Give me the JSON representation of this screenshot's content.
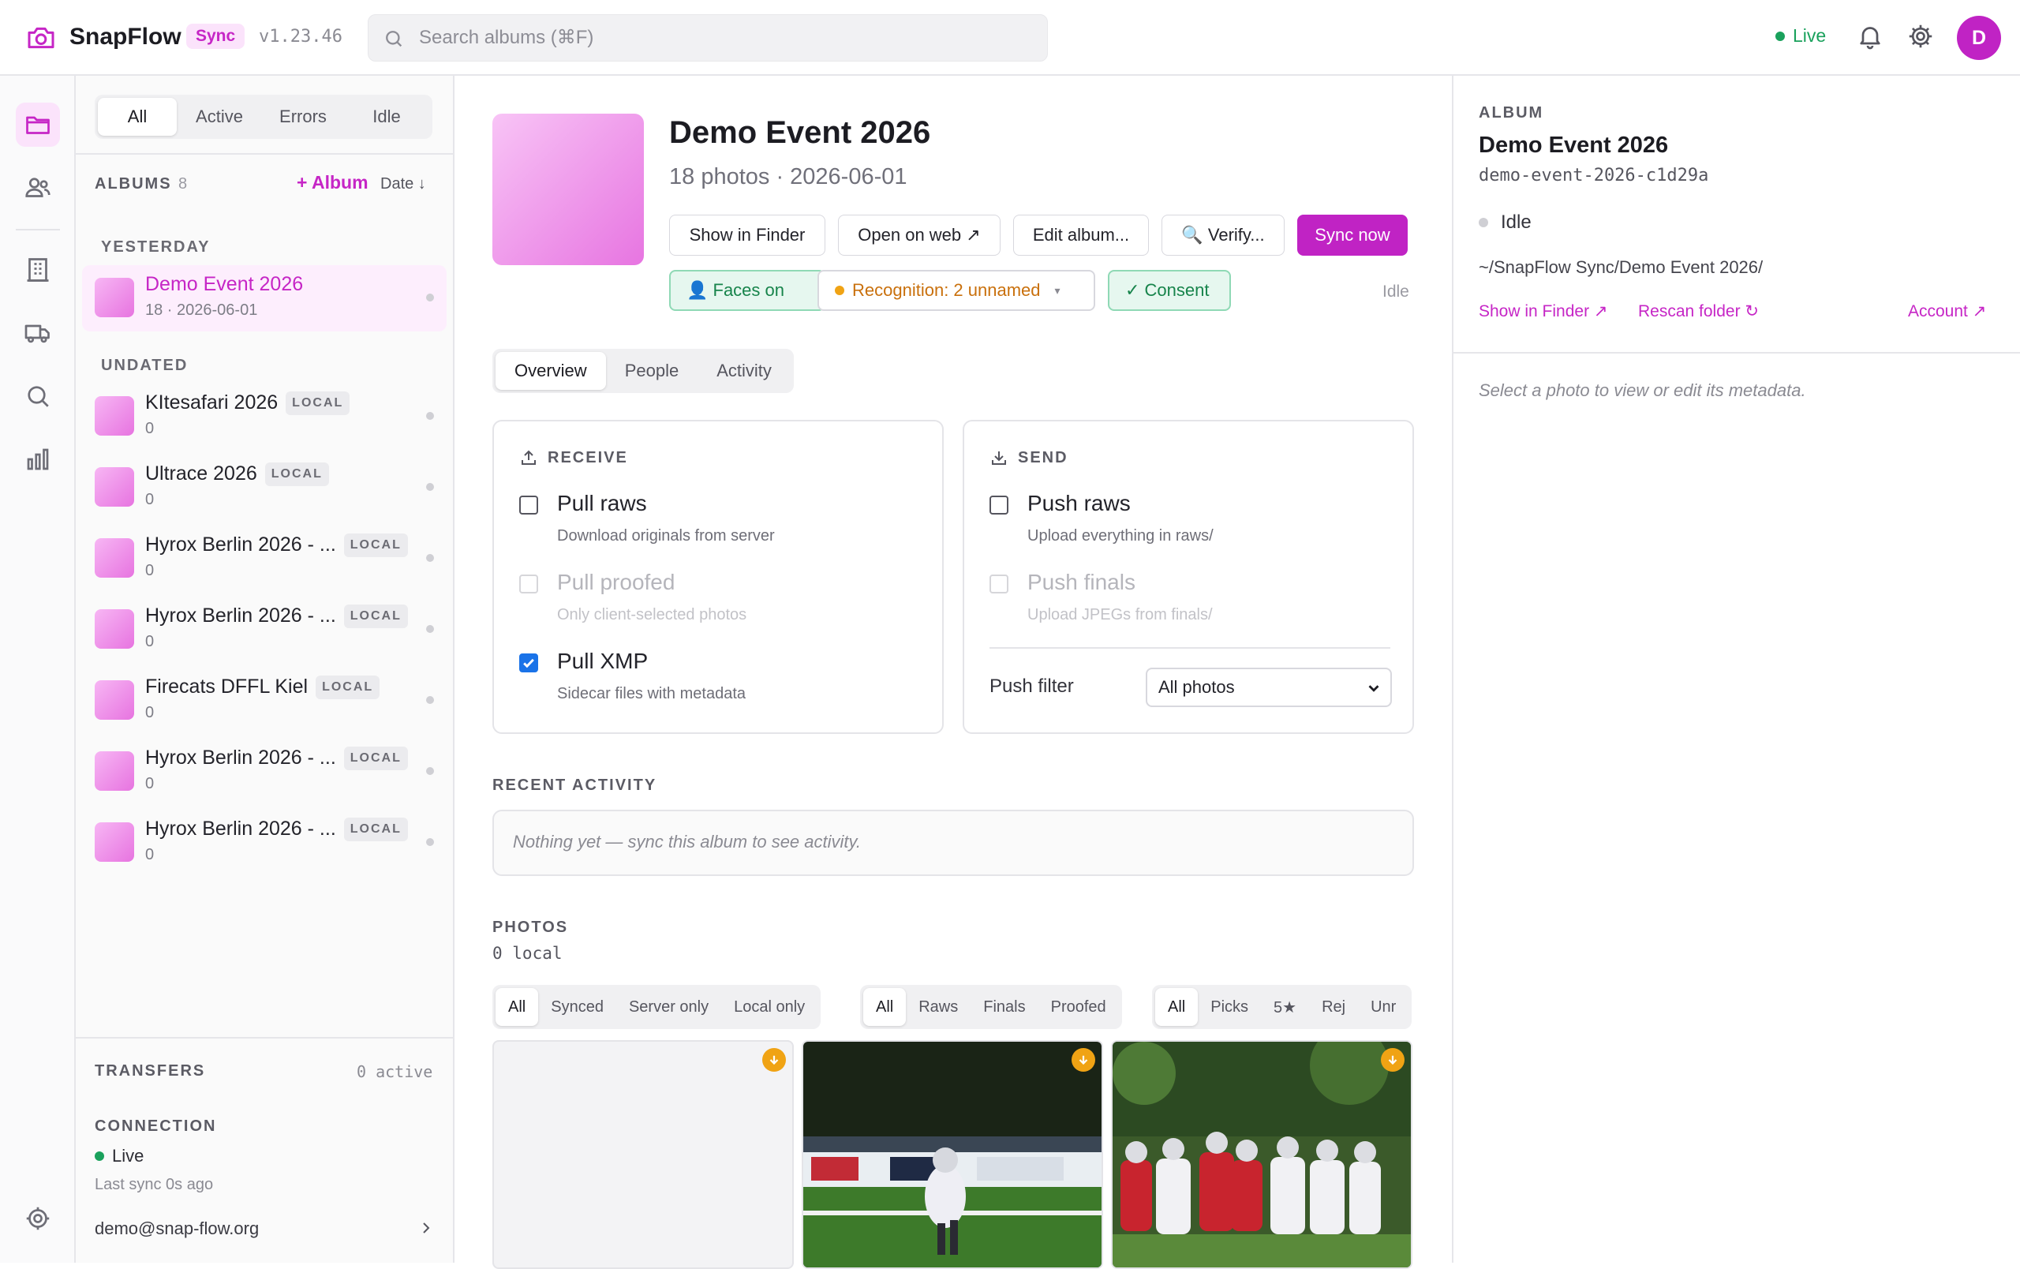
{
  "app": {
    "name": "SnapFlow",
    "badge": "Sync",
    "version": "v1.23.46",
    "search_placeholder": "Search albums (⌘F)",
    "status": "Live",
    "avatar_initial": "D",
    "brand_color": "#c023c4",
    "live_color": "#1aa15c"
  },
  "sidebar_nav": [
    "folder-icon",
    "people-icon",
    "building-icon",
    "truck-icon",
    "search-icon",
    "bar-chart-icon",
    "settings-icon"
  ],
  "album_list": {
    "filter_tabs": [
      "All",
      "Active",
      "Errors",
      "Idle"
    ],
    "active_filter": "All",
    "header": "ALBUMS",
    "count": "8",
    "add_label": "+ Album",
    "sort_label": "Date ↓",
    "groups": [
      {
        "label": "YESTERDAY",
        "albums": [
          {
            "name": "Demo Event 2026",
            "sub": "18 · 2026-06-01",
            "local": false,
            "selected": true
          }
        ]
      },
      {
        "label": "UNDATED",
        "albums": [
          {
            "name": "KItesafari 2026",
            "sub": "0",
            "local": true,
            "selected": false
          },
          {
            "name": "Ultrace 2026",
            "sub": "0",
            "local": true,
            "selected": false
          },
          {
            "name": "Hyrox Berlin 2026 - ...",
            "sub": "0",
            "local": true,
            "selected": false
          },
          {
            "name": "Hyrox Berlin 2026 - ...",
            "sub": "0",
            "local": true,
            "selected": false
          },
          {
            "name": "Firecats DFFL Kiel",
            "sub": "0",
            "local": true,
            "selected": false
          },
          {
            "name": "Hyrox Berlin 2026 - ...",
            "sub": "0",
            "local": true,
            "selected": false
          },
          {
            "name": "Hyrox Berlin 2026 - ...",
            "sub": "0",
            "local": true,
            "selected": false
          }
        ]
      }
    ],
    "local_tag": "LOCAL",
    "transfers_label": "TRANSFERS",
    "transfers_active": "0 active",
    "connection_label": "CONNECTION",
    "connection_status": "Live",
    "last_sync": "Last sync 0s ago",
    "account_email": "demo@snap-flow.org"
  },
  "album": {
    "title": "Demo Event 2026",
    "meta": "18 photos · 2026-06-01",
    "actions": {
      "show_in_finder": "Show in Finder",
      "open_on_web": "Open on web ↗",
      "edit_album": "Edit album...",
      "verify": "🔍 Verify...",
      "sync_now": "Sync now"
    },
    "chips": {
      "faces": "👤 Faces on",
      "recognition": "Recognition: 2 unnamed",
      "consent": "✓ Consent"
    },
    "state": "Idle",
    "tabs": [
      "Overview",
      "People",
      "Activity"
    ],
    "active_tab": "Overview",
    "receive": {
      "label": "RECEIVE",
      "options": [
        {
          "label": "Pull raws",
          "desc": "Download originals from server",
          "checked": false,
          "disabled": false
        },
        {
          "label": "Pull proofed",
          "desc": "Only client-selected photos",
          "checked": false,
          "disabled": true
        },
        {
          "label": "Pull XMP",
          "desc": "Sidecar files with metadata",
          "checked": true,
          "disabled": false
        }
      ]
    },
    "send": {
      "label": "SEND",
      "options": [
        {
          "label": "Push raws",
          "desc": "Upload everything in raws/",
          "checked": false,
          "disabled": false
        },
        {
          "label": "Push finals",
          "desc": "Upload JPEGs from finals/",
          "checked": false,
          "disabled": true
        }
      ],
      "push_filter_label": "Push filter",
      "push_filter_value": "All photos"
    },
    "recent_activity_label": "RECENT ACTIVITY",
    "recent_activity_empty": "Nothing yet — sync this album to see activity.",
    "photos_label": "PHOTOS",
    "photos_count": "0 local",
    "filter_location": [
      "All",
      "Synced",
      "Server only",
      "Local only"
    ],
    "filter_type": [
      "All",
      "Raws",
      "Finals",
      "Proofed"
    ],
    "filter_rating": [
      "All",
      "Picks",
      "5★",
      "Rej",
      "Unr"
    ]
  },
  "details": {
    "label": "ALBUM",
    "title": "Demo Event 2026",
    "slug": "demo-event-2026-c1d29a",
    "status": "Idle",
    "path": "~/SnapFlow Sync/Demo Event 2026/",
    "show_in_finder": "Show in Finder ↗",
    "rescan": "Rescan folder ↻",
    "account": "Account ↗",
    "empty_hint": "Select a photo to view or edit its metadata."
  }
}
